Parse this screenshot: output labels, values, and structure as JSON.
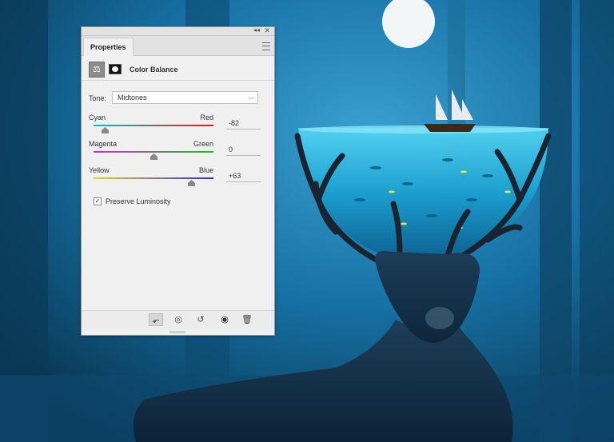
{
  "panel": {
    "tab_label": "Properties",
    "collapse_glyph": "◂◂",
    "close_glyph": "✕",
    "adjustment_title": "Color Balance",
    "tone": {
      "label": "Tone:",
      "selected": "Midtones"
    },
    "sliders": [
      {
        "left": "Cyan",
        "right": "Red",
        "value": "-82",
        "level_percent": 9
      },
      {
        "left": "Magenta",
        "right": "Green",
        "value": "0",
        "level_percent": 50
      },
      {
        "left": "Yellow",
        "right": "Blue",
        "value": "+63",
        "level_percent": 81.5
      }
    ],
    "preserve_luminosity": {
      "label": "Preserve Luminosity",
      "checked": true
    },
    "footer_icons": [
      "clip-to-layer-icon",
      "view-previous-state-icon",
      "reset-icon",
      "visibility-eye-icon",
      "trash-icon"
    ]
  },
  "colors": {
    "panel_bg": "#f0f0f0",
    "scene_dark": "#0a3f63",
    "scene_light": "#2d8fc0",
    "water": "#24b8e0"
  }
}
